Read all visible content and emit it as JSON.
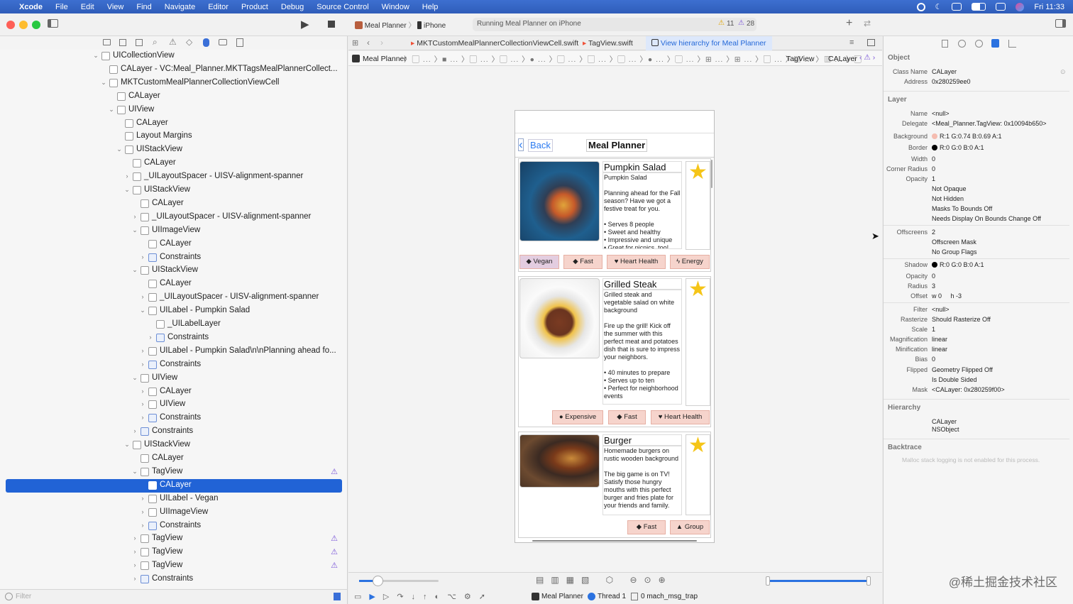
{
  "menubar": {
    "app": "Xcode",
    "items": [
      "File",
      "Edit",
      "View",
      "Find",
      "Navigate",
      "Editor",
      "Product",
      "Debug",
      "Source Control",
      "Window",
      "Help"
    ],
    "clock": "Fri 11:33"
  },
  "toolbar": {
    "scheme": "Meal Planner",
    "device": "iPhone",
    "status": "Running Meal Planner on iPhone",
    "warnings": "11",
    "issues": "28"
  },
  "tree": [
    {
      "d": 0,
      "exp": "v",
      "label": "UICollectionView"
    },
    {
      "d": 1,
      "exp": "",
      "label": "CALayer - VC:Meal_Planner.MKTTagsMealPlannerCollect..."
    },
    {
      "d": 1,
      "exp": "v",
      "label": "MKTCustomMealPlannerCollectionViewCell"
    },
    {
      "d": 2,
      "exp": "",
      "label": "CALayer"
    },
    {
      "d": 2,
      "exp": "v",
      "label": "UIView"
    },
    {
      "d": 3,
      "exp": "",
      "label": "CALayer"
    },
    {
      "d": 3,
      "exp": "",
      "label": "Layout Margins"
    },
    {
      "d": 3,
      "exp": "v",
      "label": "UIStackView"
    },
    {
      "d": 4,
      "exp": "",
      "label": "CALayer"
    },
    {
      "d": 4,
      "exp": ">",
      "label": "_UILayoutSpacer - UISV-alignment-spanner"
    },
    {
      "d": 4,
      "exp": "v",
      "label": "UIStackView"
    },
    {
      "d": 5,
      "exp": "",
      "label": "CALayer"
    },
    {
      "d": 5,
      "exp": ">",
      "label": "_UILayoutSpacer - UISV-alignment-spanner"
    },
    {
      "d": 5,
      "exp": "v",
      "label": "UIImageView"
    },
    {
      "d": 6,
      "exp": "",
      "label": "CALayer"
    },
    {
      "d": 6,
      "exp": ">",
      "label": "Constraints",
      "blue": true
    },
    {
      "d": 5,
      "exp": "v",
      "label": "UIStackView"
    },
    {
      "d": 6,
      "exp": "",
      "label": "CALayer"
    },
    {
      "d": 6,
      "exp": ">",
      "label": "_UILayoutSpacer - UISV-alignment-spanner"
    },
    {
      "d": 6,
      "exp": "v",
      "label": "UILabel - Pumpkin Salad"
    },
    {
      "d": 7,
      "exp": "",
      "label": "_UILabelLayer"
    },
    {
      "d": 7,
      "exp": ">",
      "label": "Constraints",
      "blue": true
    },
    {
      "d": 6,
      "exp": ">",
      "label": "UILabel - Pumpkin Salad\\n\\nPlanning ahead fo..."
    },
    {
      "d": 6,
      "exp": ">",
      "label": "Constraints",
      "blue": true
    },
    {
      "d": 5,
      "exp": "v",
      "label": "UIView"
    },
    {
      "d": 6,
      "exp": ">",
      "label": "CALayer"
    },
    {
      "d": 6,
      "exp": ">",
      "label": "UIView"
    },
    {
      "d": 6,
      "exp": ">",
      "label": "Constraints",
      "blue": true
    },
    {
      "d": 5,
      "exp": ">",
      "label": "Constraints",
      "blue": true
    },
    {
      "d": 4,
      "exp": "v",
      "label": "UIStackView"
    },
    {
      "d": 5,
      "exp": "",
      "label": "CALayer"
    },
    {
      "d": 5,
      "exp": "v",
      "label": "TagView",
      "warn": true
    },
    {
      "d": 6,
      "exp": "",
      "label": "CALayer",
      "sel": true
    },
    {
      "d": 6,
      "exp": ">",
      "label": "UILabel - Vegan"
    },
    {
      "d": 6,
      "exp": ">",
      "label": "UIImageView"
    },
    {
      "d": 6,
      "exp": ">",
      "label": "Constraints",
      "blue": true
    },
    {
      "d": 5,
      "exp": ">",
      "label": "TagView",
      "warn": true
    },
    {
      "d": 5,
      "exp": ">",
      "label": "TagView",
      "warn": true
    },
    {
      "d": 5,
      "exp": ">",
      "label": "TagView",
      "warn": true
    },
    {
      "d": 5,
      "exp": ">",
      "label": "Constraints",
      "blue": true
    }
  ],
  "filter": {
    "placeholder": "Filter"
  },
  "tabs": {
    "t1": "MKTCustomMealPlannerCollectionViewCell.swift",
    "t2": "TagView.swift",
    "t3": "View hierarchy for Meal Planner"
  },
  "jumpbar": {
    "first": "Meal Planner",
    "tagview": "TagView",
    "calayer": "CALayer"
  },
  "phone": {
    "back": "Back",
    "title": "Meal Planner",
    "meals": [
      {
        "name": "Pumpkin Salad",
        "desc": "Pumpkin Salad\n\nPlanning ahead for the Fall season? Have we got a festive treat for you.\n\n• Serves 8 people\n• Sweet and healthy\n• Impressive and unique\n• Great for picnics, too!",
        "tags": [
          "Vegan",
          "Fast",
          "Heart Health",
          "Energy"
        ]
      },
      {
        "name": "Grilled Steak",
        "desc": "Grilled steak and vegetable salad on white background\n\nFire up the grill! Kick off the summer with this perfect meat and potatoes dish that is sure to impress your neighbors.\n\n• 40 minutes to prepare\n• Serves up to ten\n• Perfect for neighborhood events",
        "tags": [
          "Expensive",
          "Fast",
          "Heart Health"
        ]
      },
      {
        "name": "Burger",
        "desc": "Homemade burgers on rustic wooden background\n\nThe big game is on TV! Satisfy those hungry mouths with this perfect burger and fries plate for your friends and family.",
        "tags": [
          "Fast",
          "Group"
        ]
      }
    ]
  },
  "debug": {
    "app": "Meal Planner",
    "thread": "Thread 1",
    "frame": "0 mach_msg_trap"
  },
  "inspector": {
    "object": "Object",
    "class_name_k": "Class Name",
    "class_name": "CALayer",
    "address_k": "Address",
    "address": "0x280259ee0",
    "layer": "Layer",
    "name_k": "Name",
    "name": "<null>",
    "delegate_k": "Delegate",
    "delegate": "<Meal_Planner.TagView: 0x10094b650>",
    "background_k": "Background",
    "background": "R:1 G:0.74 B:0.69 A:1",
    "background_color": "#f5bcb0",
    "border_k": "Border",
    "border": "R:0 G:0 B:0 A:1",
    "width_k": "Width",
    "width": "0",
    "corner_k": "Corner Radius",
    "corner": "0",
    "opacity_k": "Opacity",
    "opacity": "1",
    "flags": [
      "Not Opaque",
      "Not Hidden",
      "Masks To Bounds Off",
      "Needs Display On Bounds Change Off"
    ],
    "offscreens_k": "Offscreens",
    "offscreens": "2",
    "off_flags": [
      "Offscreen Mask",
      "No Group Flags"
    ],
    "shadow_k": "Shadow",
    "shadow": "R:0 G:0 B:0 A:1",
    "s_opacity_k": "Opacity",
    "s_opacity": "0",
    "radius_k": "Radius",
    "radius": "3",
    "offset_k": "Offset",
    "offset": "w 0     h -3",
    "filter_k": "Filter",
    "filter": "<null>",
    "rasterize_k": "Rasterize",
    "rasterize": "Should Rasterize Off",
    "scale_k": "Scale",
    "scale": "1",
    "mag_k": "Magnification",
    "mag": "linear",
    "min_k": "Minification",
    "min": "linear",
    "bias_k": "Bias",
    "bias": "0",
    "flipped_k": "Flipped",
    "flipped": "Geometry Flipped Off",
    "double": "Is Double Sided",
    "mask_k": "Mask",
    "mask": "<CALayer: 0x280259f00>",
    "hierarchy": "Hierarchy",
    "h1": "CALayer",
    "h2": "NSObject",
    "backtrace": "Backtrace",
    "bt_note": "Malloc stack logging is not enabled for this process."
  },
  "watermark": "@稀土掘金技术社区"
}
